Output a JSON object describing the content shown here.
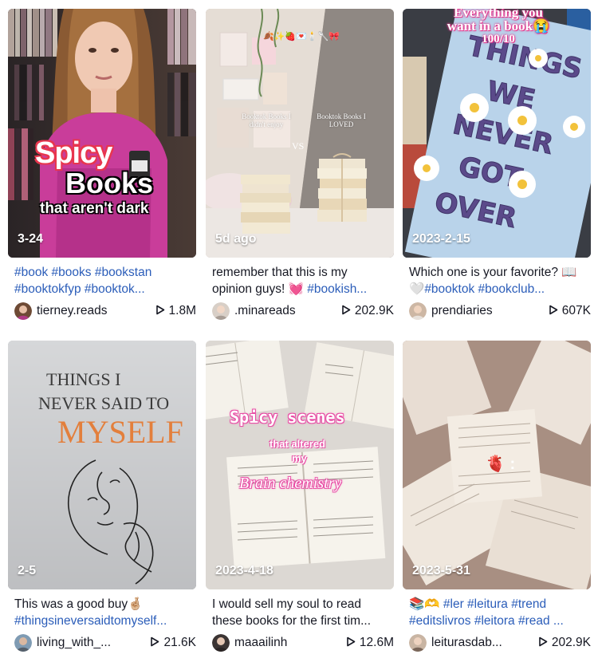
{
  "cards": [
    {
      "date": "3-24",
      "desc_line1": "#book #books #bookstan",
      "desc_line2": "#booktokfyp #booktok...",
      "username": "tierney.reads",
      "views": "1.8M",
      "overlay": {
        "spicy": "Spicy",
        "books": "Books",
        "sub": "that aren't dark"
      }
    },
    {
      "date": "5d ago",
      "desc_line1_text": "remember that this is my",
      "desc_line2_text": "opinion guys! 💓 ",
      "desc_line2_tag": "#bookish...",
      "username": ".minareads",
      "views": "202.9K",
      "overlay": {
        "left": "Booktok Books I didn't enjoy",
        "vs": "VS",
        "right": "Booktok Books I LOVED",
        "emoji": "🍂✨🍓💌🕯️🥄🎀"
      }
    },
    {
      "date": "2023-2-15",
      "desc_line1_text": "Which one is your favorite? 📖",
      "desc_line2_text": "🤍",
      "desc_line2_tag": "#booktok #bookclub...",
      "username": "prendiaries",
      "views": "607K",
      "overlay": {
        "top1": "Everything you",
        "top2": "want in a book😭",
        "top3": "100/10",
        "book_title": "THINGS WE NEVER GOT OVER"
      }
    },
    {
      "date": "2-5",
      "desc_line1_text": "This was a good buy🤞🏼",
      "desc_line2_tag": "#thingsineversaidtomyself...",
      "username": "living_with_...",
      "views": "21.6K",
      "overlay": {
        "book_title1": "THINGS I",
        "book_title2": "NEVER SAID TO",
        "book_title3": "MYSELF"
      }
    },
    {
      "date": "2023-4-18",
      "desc_line1_text": "I would sell my soul to read",
      "desc_line2_text": "these books for the first tim...",
      "username": "maaailinh",
      "views": "12.6M",
      "overlay": {
        "spicy": "Spicy scenes",
        "mid": "that altered",
        "my": "my",
        "brain": "Brain chemistry"
      }
    },
    {
      "date": "2023-5-31",
      "desc_line1_text": "📚🫶 ",
      "desc_line1_tag": "#ler #leitura #trend",
      "desc_line2_tag": "#editslivros #leitora #read ...",
      "username": "leiturasdab...",
      "views": "202.9K",
      "overlay": {
        "emoji": "🫀 :"
      }
    }
  ],
  "colors": {
    "hashtag": "#2b5db9",
    "text": "#161823"
  },
  "icons": {
    "play": "play-outline-icon"
  }
}
